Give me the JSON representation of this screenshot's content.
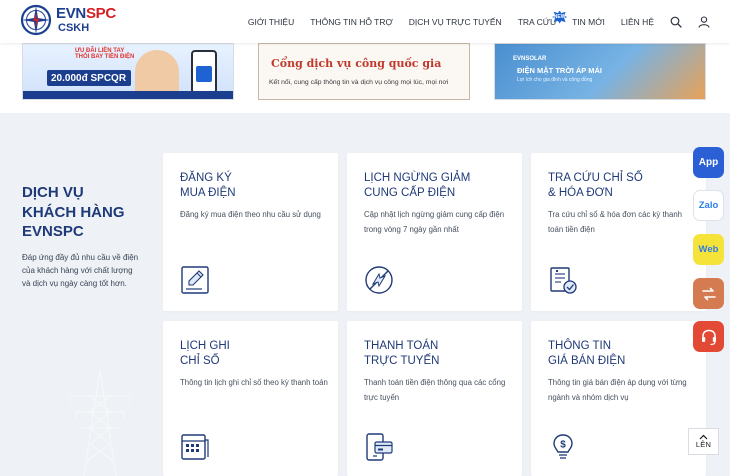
{
  "header": {
    "brand_main": "EVN",
    "brand_accent": "SPC",
    "brand_sub": "CSKH",
    "nav": [
      {
        "label": "GIỚI THIỆU"
      },
      {
        "label": "THÔNG TIN HỖ TRỢ"
      },
      {
        "label": "DỊCH VỤ TRỰC TUYẾN"
      },
      {
        "label": "TRA CỨU",
        "badge": "NEW"
      },
      {
        "label": "TIN MỚI"
      },
      {
        "label": "LIÊN HỆ"
      }
    ],
    "icons": [
      "search-icon",
      "user-icon"
    ]
  },
  "banners": [
    {
      "headline": "ƯU ĐÃI LIỀN TAY\nTHỎI BAY TIỀN ĐIỆN",
      "code": "20.000đ SPCQR"
    },
    {
      "title": "Cổng dịch vụ công quốc gia",
      "subtitle": "Kết nối, cung cấp thông tin và dịch vụ công mọi lúc, mọi nơi"
    },
    {
      "brand": "EVNSOLAR",
      "title": "ĐIỆN MẶT TRỜI ÁP MÁI",
      "subtitle": "Lợi ích cho gia đình và cộng đồng"
    }
  ],
  "section": {
    "title": "DỊCH VỤ\nKHÁCH HÀNG\nEVNSPC",
    "description": "Đáp ứng đầy đủ nhu cầu về điện của khách hàng với chất lượng và dịch vụ ngày càng tốt hơn."
  },
  "services": [
    {
      "title": "ĐĂNG KÝ\nMUA ĐIỆN",
      "description": "Đăng ký mua điện theo nhu cầu sử dụng",
      "icon": "document-pen-icon"
    },
    {
      "title": "LỊCH NGỪNG GIẢM\nCUNG CẤP ĐIỆN",
      "description": "Cập nhật lịch ngừng giảm cung cấp điện trong vòng 7 ngày gần nhất",
      "icon": "power-off-icon"
    },
    {
      "title": "TRA CỨU CHỈ SỐ\n& HÓA ĐƠN",
      "description": "Tra cứu chỉ số & hóa đơn các kỳ thanh toán tiền điện",
      "icon": "invoice-check-icon"
    },
    {
      "title": "LỊCH GHI\nCHỈ SỐ",
      "description": "Thông tin lịch ghi chỉ số theo kỳ thanh toán",
      "icon": "calendar-icon"
    },
    {
      "title": "THANH TOÁN\nTRỰC TUYẾN",
      "description": "Thanh toán tiền điện thông qua các cổng trực tuyến",
      "icon": "mobile-card-icon"
    },
    {
      "title": "THÔNG TIN\nGIÁ BÁN ĐIỆN",
      "description": "Thông tin giá bán điện áp dụng với từng ngành và nhóm dịch vụ",
      "icon": "bulb-dollar-icon"
    }
  ],
  "floating": {
    "app": "App",
    "zalo": "Zalo",
    "web": "Web"
  },
  "back_to_top": "LÊN",
  "colors": {
    "primary": "#1f3a78",
    "brand_red": "#d71f26",
    "background": "#eef1f5"
  }
}
